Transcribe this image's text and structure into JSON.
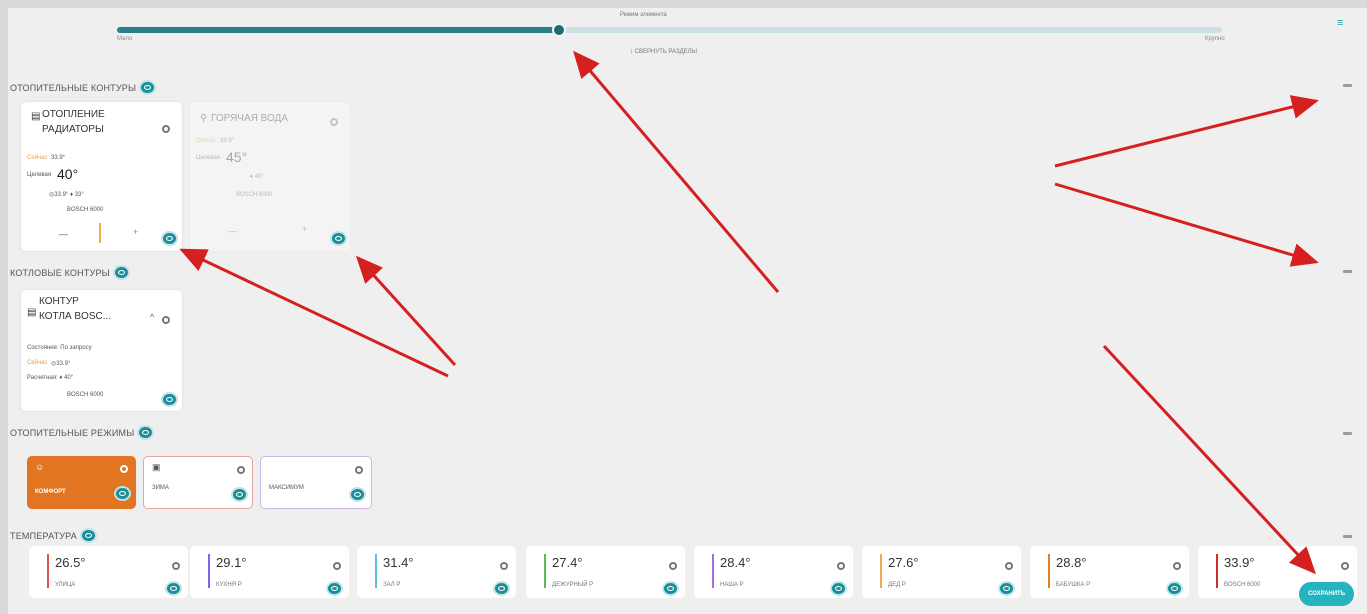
{
  "slider": {
    "title": "Режим элемента",
    "left_label": "Мало",
    "right_label": "Крупно",
    "value_fraction": 0.4
  },
  "collapse_label": "↕ СВЕРНУТЬ РАЗДЕЛЫ",
  "sections": {
    "heating": "ОТОПИТЕЛЬНЫЕ КОНТУРЫ",
    "boiler": "КОТЛОВЫЕ КОНТУРЫ",
    "modes": "ОТОПИТЕЛЬНЫЕ РЕЖИМЫ",
    "temperature": "ТЕМПЕРАТУРА"
  },
  "heating_cards": [
    {
      "title_line1": "ОТОПЛЕНИЕ",
      "title_line2": "РАДИАТОРЫ",
      "now_label": "Сейчас",
      "now_value": "33.9°",
      "target_label": "Целевая",
      "target_value": "40°",
      "extra": "◎33.9°  ♦ 33°",
      "device": "BOSCH 6000",
      "minus": "—",
      "plus": "+"
    },
    {
      "title_line1": "ГОРЯЧАЯ ВОДА",
      "title_line2": "",
      "now_label": "Сейчас",
      "now_value": "33.9°",
      "target_label": "Целевая",
      "target_value": "45°",
      "extra": "♦ 45°",
      "device": "BOSCH 6000",
      "minus": "—",
      "plus": "+"
    }
  ],
  "boiler_card": {
    "title_line1": "КОНТУР",
    "title_line2": "КОТЛА BOSC...",
    "state": "Состояние: По запросу",
    "now_label": "Сейчас",
    "now_value": "◎33.9°",
    "calc": "Расчетная: ♦ 40°",
    "device": "BOSCH 6000"
  },
  "modes": [
    {
      "label": "КОМФОРТ",
      "active": true
    },
    {
      "label": "ЗИМА",
      "active": false
    },
    {
      "label": "МАКСИМУМ",
      "active": false
    }
  ],
  "temperatures": [
    {
      "value": "26.5°",
      "name": "УЛИЦА",
      "color": "#d9534f"
    },
    {
      "value": "29.1°",
      "name": "КУХНЯ Р",
      "color": "#7b68ee"
    },
    {
      "value": "31.4°",
      "name": "ЗАЛ Р",
      "color": "#5bc0de"
    },
    {
      "value": "27.4°",
      "name": "ДЕЖУРНЫЙ Р",
      "color": "#5cb85c"
    },
    {
      "value": "28.4°",
      "name": "НАША Р",
      "color": "#a56de2"
    },
    {
      "value": "27.6°",
      "name": "ДЕД Р",
      "color": "#f0ad4e"
    },
    {
      "value": "28.8°",
      "name": "БАБУШКА Р",
      "color": "#e67e22"
    },
    {
      "value": "33.9°",
      "name": "BOSCH 6000",
      "color": "#c9302c"
    }
  ],
  "save_label": "СОХРАНИТЬ",
  "colors": {
    "accent": "#1b8e97",
    "active_mode": "#e27522",
    "annotation_arrow": "#d62020"
  }
}
